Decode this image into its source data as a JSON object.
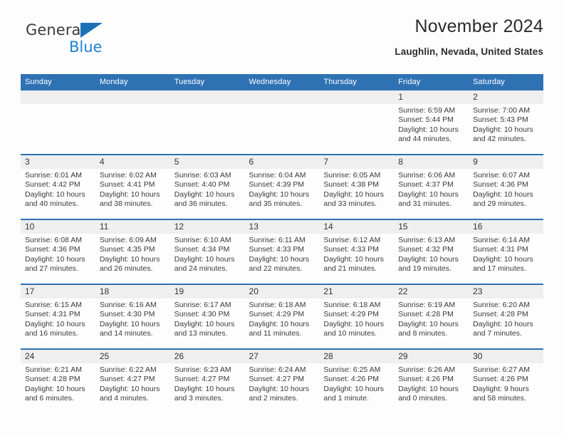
{
  "logo": {
    "word1": "General",
    "word2": "Blue",
    "flag_color": "#1c70b8",
    "word2_color": "#1c83d4"
  },
  "header": {
    "month_title": "November 2024",
    "location": "Laughlin, Nevada, United States"
  },
  "theme": {
    "header_blue": "#2e72b4",
    "daynum_band": "#efefef",
    "page_background": "#fdfdfd",
    "text": "#3a3a3a"
  },
  "weekdays": [
    "Sunday",
    "Monday",
    "Tuesday",
    "Wednesday",
    "Thursday",
    "Friday",
    "Saturday"
  ],
  "weeks": [
    [
      {
        "day": "",
        "sunrise": "",
        "sunset": "",
        "daylight": ""
      },
      {
        "day": "",
        "sunrise": "",
        "sunset": "",
        "daylight": ""
      },
      {
        "day": "",
        "sunrise": "",
        "sunset": "",
        "daylight": ""
      },
      {
        "day": "",
        "sunrise": "",
        "sunset": "",
        "daylight": ""
      },
      {
        "day": "",
        "sunrise": "",
        "sunset": "",
        "daylight": ""
      },
      {
        "day": "1",
        "sunrise": "Sunrise: 6:59 AM",
        "sunset": "Sunset: 5:44 PM",
        "daylight": "Daylight: 10 hours and 44 minutes."
      },
      {
        "day": "2",
        "sunrise": "Sunrise: 7:00 AM",
        "sunset": "Sunset: 5:43 PM",
        "daylight": "Daylight: 10 hours and 42 minutes."
      }
    ],
    [
      {
        "day": "3",
        "sunrise": "Sunrise: 6:01 AM",
        "sunset": "Sunset: 4:42 PM",
        "daylight": "Daylight: 10 hours and 40 minutes."
      },
      {
        "day": "4",
        "sunrise": "Sunrise: 6:02 AM",
        "sunset": "Sunset: 4:41 PM",
        "daylight": "Daylight: 10 hours and 38 minutes."
      },
      {
        "day": "5",
        "sunrise": "Sunrise: 6:03 AM",
        "sunset": "Sunset: 4:40 PM",
        "daylight": "Daylight: 10 hours and 36 minutes."
      },
      {
        "day": "6",
        "sunrise": "Sunrise: 6:04 AM",
        "sunset": "Sunset: 4:39 PM",
        "daylight": "Daylight: 10 hours and 35 minutes."
      },
      {
        "day": "7",
        "sunrise": "Sunrise: 6:05 AM",
        "sunset": "Sunset: 4:38 PM",
        "daylight": "Daylight: 10 hours and 33 minutes."
      },
      {
        "day": "8",
        "sunrise": "Sunrise: 6:06 AM",
        "sunset": "Sunset: 4:37 PM",
        "daylight": "Daylight: 10 hours and 31 minutes."
      },
      {
        "day": "9",
        "sunrise": "Sunrise: 6:07 AM",
        "sunset": "Sunset: 4:36 PM",
        "daylight": "Daylight: 10 hours and 29 minutes."
      }
    ],
    [
      {
        "day": "10",
        "sunrise": "Sunrise: 6:08 AM",
        "sunset": "Sunset: 4:36 PM",
        "daylight": "Daylight: 10 hours and 27 minutes."
      },
      {
        "day": "11",
        "sunrise": "Sunrise: 6:09 AM",
        "sunset": "Sunset: 4:35 PM",
        "daylight": "Daylight: 10 hours and 26 minutes."
      },
      {
        "day": "12",
        "sunrise": "Sunrise: 6:10 AM",
        "sunset": "Sunset: 4:34 PM",
        "daylight": "Daylight: 10 hours and 24 minutes."
      },
      {
        "day": "13",
        "sunrise": "Sunrise: 6:11 AM",
        "sunset": "Sunset: 4:33 PM",
        "daylight": "Daylight: 10 hours and 22 minutes."
      },
      {
        "day": "14",
        "sunrise": "Sunrise: 6:12 AM",
        "sunset": "Sunset: 4:33 PM",
        "daylight": "Daylight: 10 hours and 21 minutes."
      },
      {
        "day": "15",
        "sunrise": "Sunrise: 6:13 AM",
        "sunset": "Sunset: 4:32 PM",
        "daylight": "Daylight: 10 hours and 19 minutes."
      },
      {
        "day": "16",
        "sunrise": "Sunrise: 6:14 AM",
        "sunset": "Sunset: 4:31 PM",
        "daylight": "Daylight: 10 hours and 17 minutes."
      }
    ],
    [
      {
        "day": "17",
        "sunrise": "Sunrise: 6:15 AM",
        "sunset": "Sunset: 4:31 PM",
        "daylight": "Daylight: 10 hours and 16 minutes."
      },
      {
        "day": "18",
        "sunrise": "Sunrise: 6:16 AM",
        "sunset": "Sunset: 4:30 PM",
        "daylight": "Daylight: 10 hours and 14 minutes."
      },
      {
        "day": "19",
        "sunrise": "Sunrise: 6:17 AM",
        "sunset": "Sunset: 4:30 PM",
        "daylight": "Daylight: 10 hours and 13 minutes."
      },
      {
        "day": "20",
        "sunrise": "Sunrise: 6:18 AM",
        "sunset": "Sunset: 4:29 PM",
        "daylight": "Daylight: 10 hours and 11 minutes."
      },
      {
        "day": "21",
        "sunrise": "Sunrise: 6:18 AM",
        "sunset": "Sunset: 4:29 PM",
        "daylight": "Daylight: 10 hours and 10 minutes."
      },
      {
        "day": "22",
        "sunrise": "Sunrise: 6:19 AM",
        "sunset": "Sunset: 4:28 PM",
        "daylight": "Daylight: 10 hours and 8 minutes."
      },
      {
        "day": "23",
        "sunrise": "Sunrise: 6:20 AM",
        "sunset": "Sunset: 4:28 PM",
        "daylight": "Daylight: 10 hours and 7 minutes."
      }
    ],
    [
      {
        "day": "24",
        "sunrise": "Sunrise: 6:21 AM",
        "sunset": "Sunset: 4:28 PM",
        "daylight": "Daylight: 10 hours and 6 minutes."
      },
      {
        "day": "25",
        "sunrise": "Sunrise: 6:22 AM",
        "sunset": "Sunset: 4:27 PM",
        "daylight": "Daylight: 10 hours and 4 minutes."
      },
      {
        "day": "26",
        "sunrise": "Sunrise: 6:23 AM",
        "sunset": "Sunset: 4:27 PM",
        "daylight": "Daylight: 10 hours and 3 minutes."
      },
      {
        "day": "27",
        "sunrise": "Sunrise: 6:24 AM",
        "sunset": "Sunset: 4:27 PM",
        "daylight": "Daylight: 10 hours and 2 minutes."
      },
      {
        "day": "28",
        "sunrise": "Sunrise: 6:25 AM",
        "sunset": "Sunset: 4:26 PM",
        "daylight": "Daylight: 10 hours and 1 minute."
      },
      {
        "day": "29",
        "sunrise": "Sunrise: 6:26 AM",
        "sunset": "Sunset: 4:26 PM",
        "daylight": "Daylight: 10 hours and 0 minutes."
      },
      {
        "day": "30",
        "sunrise": "Sunrise: 6:27 AM",
        "sunset": "Sunset: 4:26 PM",
        "daylight": "Daylight: 9 hours and 58 minutes."
      }
    ]
  ]
}
